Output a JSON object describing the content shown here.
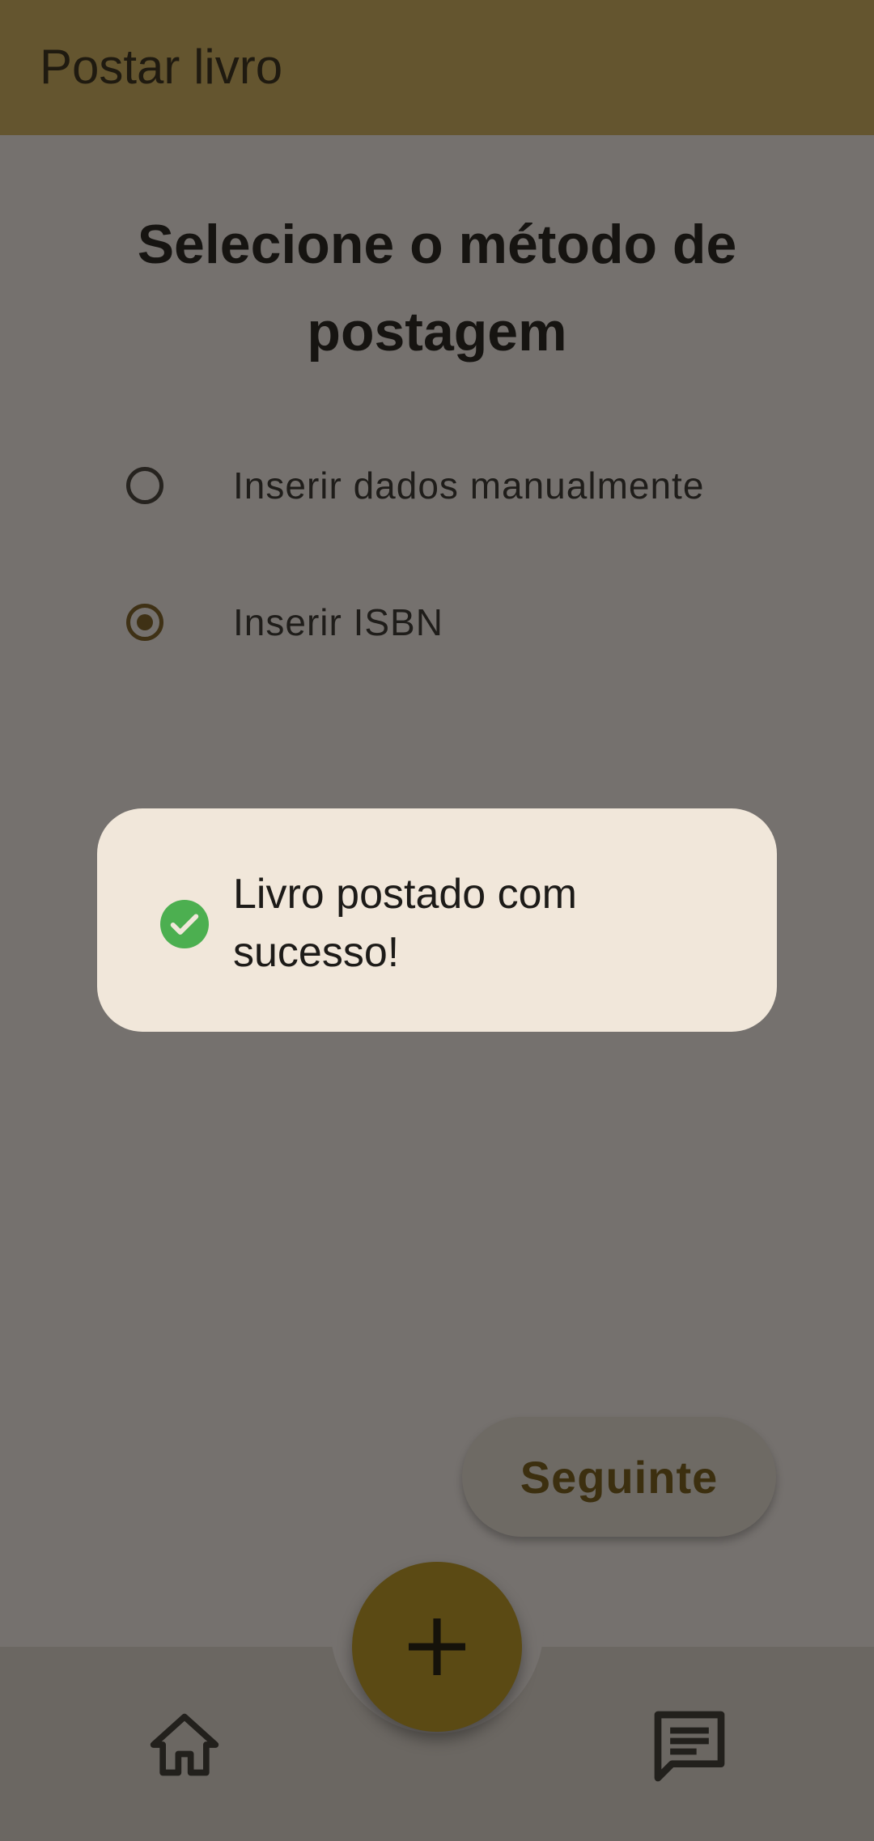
{
  "appbar": {
    "title": "Postar livro"
  },
  "heading": "Selecione o método de postagem",
  "options": [
    {
      "label": "Inserir dados manualmente",
      "selected": false
    },
    {
      "label": "Inserir ISBN",
      "selected": true
    }
  ],
  "toast": {
    "message": "Livro postado com sucesso!",
    "icon": "check-circle-icon"
  },
  "next_button": {
    "label": "Seguinte"
  },
  "bottom_nav": {
    "items": [
      {
        "icon": "home-icon"
      },
      {
        "icon": "add-icon"
      },
      {
        "icon": "chat-icon"
      }
    ]
  },
  "colors": {
    "appbar": "#64552f",
    "scrim": "#75716e",
    "fab": "#5b4a14",
    "toast_bg": "#f1e7da",
    "success": "#4caf50"
  }
}
